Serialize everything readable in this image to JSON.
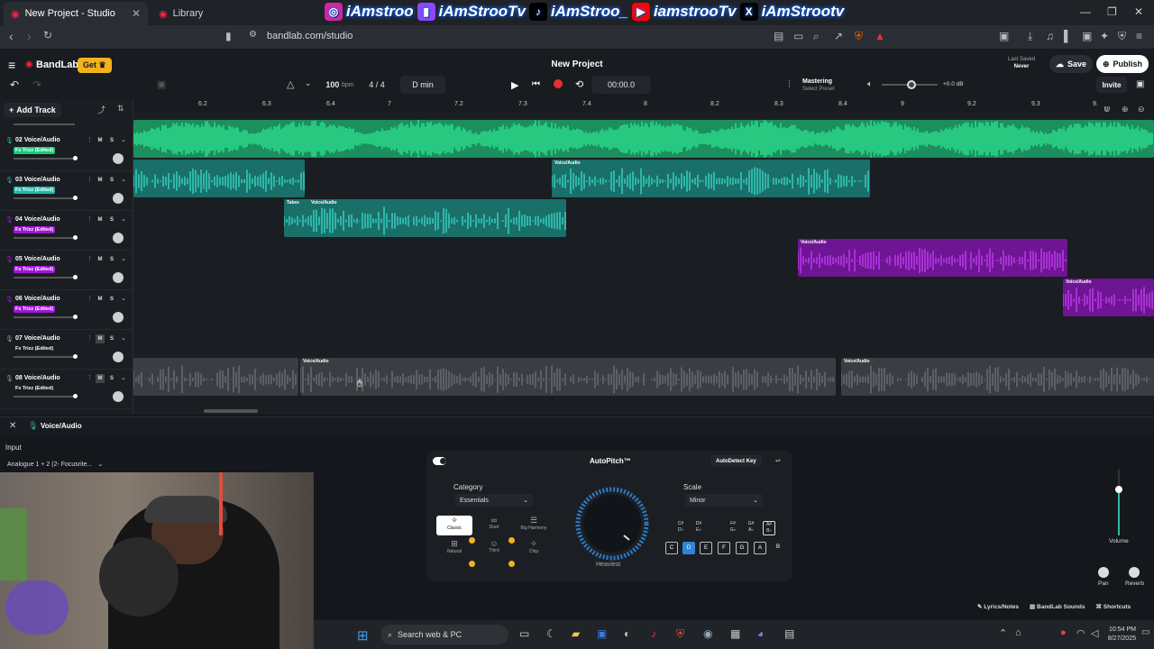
{
  "browser": {
    "tabs": [
      {
        "title": "New Project - Studio",
        "active": true
      },
      {
        "title": "Library",
        "active": false
      }
    ],
    "url": "bandlab.com/studio",
    "banner": [
      "iAmstroo",
      "iAmStrooTv",
      "iAmStroo_",
      "iamstrooTv",
      "iAmStrootv"
    ]
  },
  "header": {
    "brand": "BandLab",
    "get_label": "Get",
    "project_title": "New Project",
    "last_saved_label": "Last Saved",
    "last_saved_value": "Never",
    "save_label": "Save",
    "publish_label": "Publish",
    "invite_label": "Invite",
    "bpm_value": "100",
    "bpm_unit": "bpm",
    "time_sig": "4 / 4",
    "key": "D min",
    "time": "00:00.0",
    "mastering_label": "Mastering",
    "mastering_sub": "Select Preset",
    "db": "+0.0 dB"
  },
  "timeline": {
    "add_track_label": "Add Track",
    "ruler": [
      "6.2",
      "6.3",
      "6.4",
      "7",
      "7.2",
      "7.3",
      "7.4",
      "8",
      "8.2",
      "8.3",
      "8.4",
      "9",
      "9.2",
      "9.3",
      "9."
    ],
    "tracks": [
      {
        "name": "02 Voice/Audio",
        "fx": "Fx Trizz (Edited)",
        "color": "#18c97a"
      },
      {
        "name": "03 Voice/Audio",
        "fx": "Fx Trizz (Edited)",
        "color": "#1fb8a8"
      },
      {
        "name": "04 Voice/Audio",
        "fx": "Fx Trizz (Edited)",
        "color": "#a016d6"
      },
      {
        "name": "05 Voice/Audio",
        "fx": "Fx Trizz (Edited)",
        "color": "#a016d6"
      },
      {
        "name": "06 Voice/Audio",
        "fx": "Fx Trizz (Edited)",
        "color": "#a016d6"
      },
      {
        "name": "07 Voice/Audio",
        "fx": "Fx Trizz (Edited)",
        "color": "#777777"
      },
      {
        "name": "08 Voice/Audio",
        "fx": "Fx Trizz (Edited)",
        "color": "#777777"
      }
    ],
    "clip_labels": {
      "voice": "Voice/Audio",
      "takes": "Takes"
    }
  },
  "panel": {
    "track_title": "Voice/Audio",
    "input_label": "Input",
    "input_value": "Analogue 1 + 2 (2- Focusrite...",
    "autopitch_title": "AutoPitch™",
    "autodetect_label": "AutoDetect Key",
    "category_label": "Category",
    "category_value": "Essentials",
    "scale_label": "Scale",
    "scale_value": "Minor",
    "knob_label": "Heaviest",
    "categories": [
      "Classic",
      "Duet",
      "Big Harmony",
      "Natural",
      "Third",
      "Chip"
    ],
    "sharp_keys": [
      "C#\nD♭",
      "D#\nE♭",
      "F#\nG♭",
      "G#\nA♭",
      "A#\nB♭"
    ],
    "keys": [
      "C",
      "D",
      "E",
      "F",
      "G",
      "A",
      "B"
    ],
    "volume_label": "Volume",
    "pan_label": "Pan",
    "reverb_label": "Reverb",
    "footer_links": [
      "Lyrics/Notes",
      "BandLab Sounds",
      "Shortcuts"
    ]
  },
  "taskbar": {
    "search_placeholder": "Search web & PC",
    "time": "10:54 PM",
    "date": "8/27/2025"
  },
  "colors": {
    "green": "#18c97a",
    "teal": "#1fb8a8",
    "purple": "#a016d6",
    "accent_blue": "#2f86d8",
    "get_yellow": "#f3b21c"
  }
}
